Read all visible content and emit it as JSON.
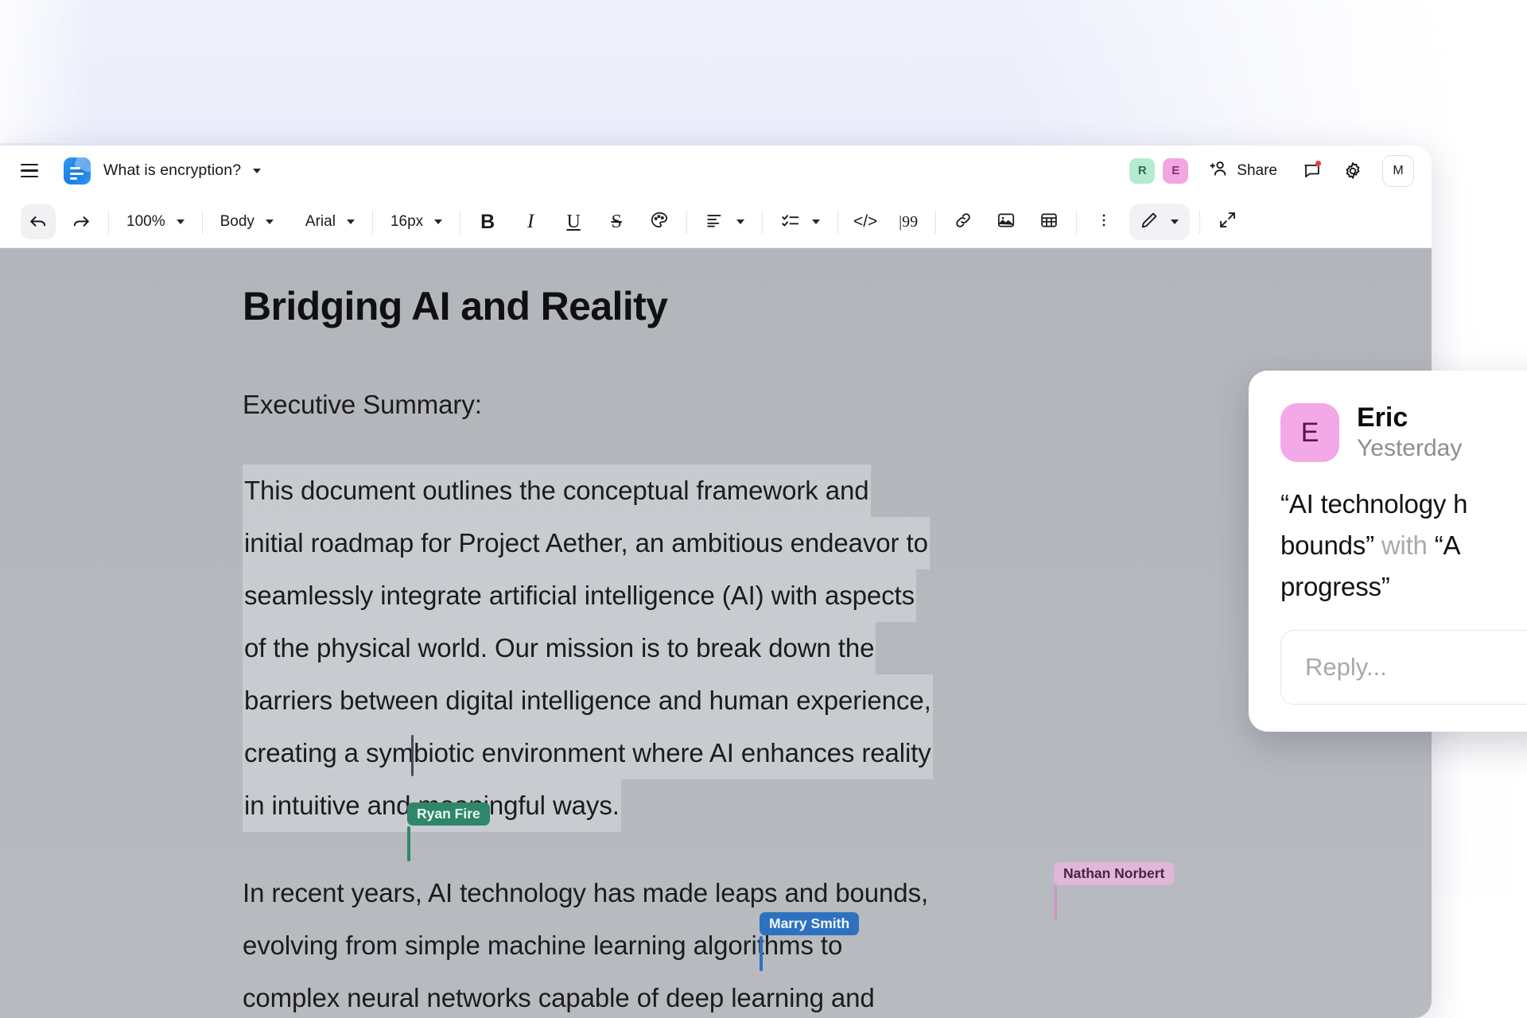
{
  "header": {
    "menu_icon": "hamburger-icon",
    "doc_icon": "document-icon",
    "doc_title": "What is encryption?",
    "title_caret": "chevron-down-icon",
    "avatars": [
      {
        "initial": "R",
        "color": "#b4ecd0"
      },
      {
        "initial": "E",
        "color": "#f0a6e0"
      }
    ],
    "share_label": "Share",
    "share_icon": "add-person-icon",
    "comment_icon": "comment-icon",
    "comment_badge": true,
    "settings_icon": "gear-icon",
    "user_chip": "M"
  },
  "toolbar": {
    "undo_icon": "undo-icon",
    "redo_icon": "redo-icon",
    "zoom_value": "100%",
    "style_value": "Body",
    "font_value": "Arial",
    "size_value": "16px",
    "bold_label": "B",
    "italic_label": "I",
    "underline_label": "U",
    "strike_label": "S",
    "color_icon": "palette-icon",
    "align_icon": "align-left-icon",
    "checklist_icon": "checklist-icon",
    "code_label": "</>",
    "quote_label": "|99",
    "link_icon": "link-icon",
    "image_icon": "image-icon",
    "table_icon": "table-icon",
    "more_icon": "kebab-menu-icon",
    "pen_icon": "pencil-icon",
    "expand_icon": "expand-icon"
  },
  "document": {
    "title": "Bridging AI and Reality",
    "lead_label": "Executive Summary:",
    "selected_paragraph_lines": [
      "This document outlines the conceptual framework and",
      "initial roadmap for Project Aether, an ambitious endeavor to",
      "seamlessly integrate artificial intelligence (AI) with aspects",
      "of the physical world. Our mission is to break down the",
      "barriers between digital intelligence and human experience,",
      "creating a symbiotic environment where AI enhances reality",
      "in intuitive and meaningful ways."
    ],
    "paragraph_2_lines": [
      "In recent years, AI technology has made leaps and bounds,",
      "evolving from simple machine learning algorithms to",
      "complex neural networks capable of deep learning and"
    ]
  },
  "collaborators": [
    {
      "name": "Ryan Fire",
      "color": "#2f8669"
    },
    {
      "name": "Nathan Norbert",
      "color": "#e0b7d8"
    },
    {
      "name": "Marry Smith",
      "color": "#2e72bf"
    }
  ],
  "comment": {
    "avatar_initial": "E",
    "avatar_color": "#f3a8e8",
    "author": "Eric",
    "timestamp": "Yesterday",
    "quote_1": "“AI technology h",
    "line2_quote_start": "bounds”",
    "line2_muted": "with",
    "line2_quote_open": "“A",
    "line3": "progress”",
    "reply_placeholder": "Reply..."
  }
}
